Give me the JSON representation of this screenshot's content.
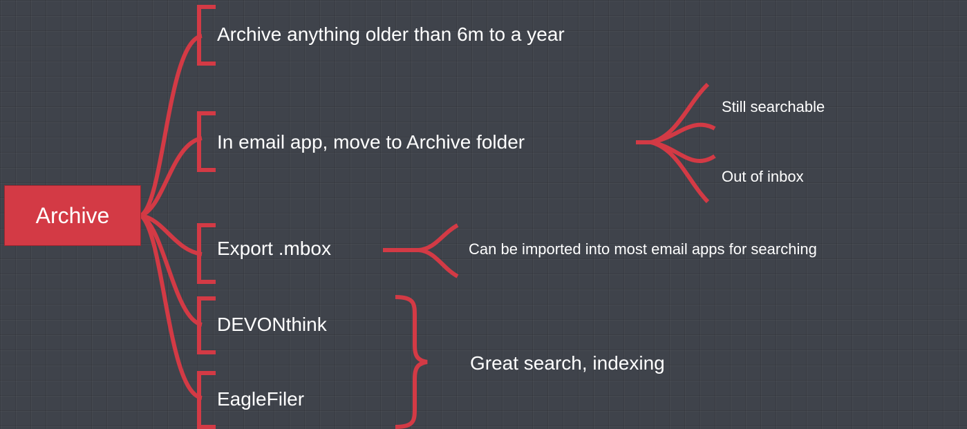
{
  "root": {
    "label": "Archive"
  },
  "branches": [
    {
      "label": "Archive anything older than 6m to a year"
    },
    {
      "label": "In email app, move to Archive folder",
      "children": [
        {
          "label": "Still searchable"
        },
        {
          "label": "Out of inbox"
        }
      ]
    },
    {
      "label": "Export .mbox",
      "children": [
        {
          "label": "Can be imported into most email apps for searching"
        }
      ]
    },
    {
      "label": "DEVONthink"
    },
    {
      "label": "EagleFiler"
    }
  ],
  "summary": {
    "label": "Great search, indexing"
  },
  "colors": {
    "accent": "#d33a45",
    "background": "#3f434b",
    "text": "#ffffff"
  }
}
